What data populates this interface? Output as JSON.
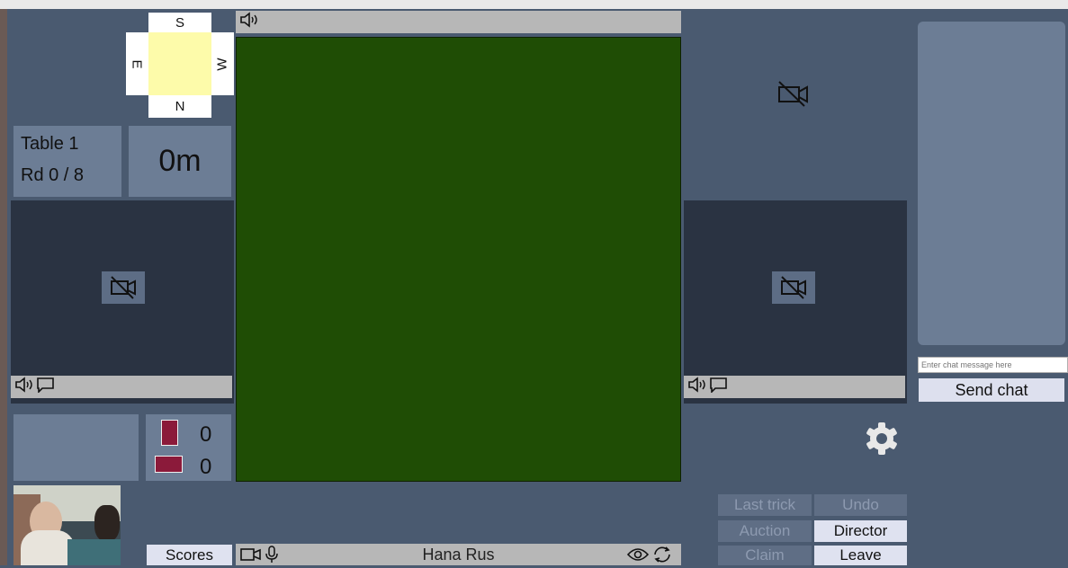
{
  "compass": {
    "south": "S",
    "north": "N",
    "east": "E",
    "west": "W"
  },
  "table": {
    "name": "Table 1",
    "round": "Rd 0 / 8",
    "timer": "0m"
  },
  "counts": {
    "vertical": "0",
    "horizontal": "0"
  },
  "chat": {
    "placeholder": "Enter chat message here",
    "send_label": "Send chat"
  },
  "buttons": {
    "scores": "Scores",
    "last_trick": "Last trick",
    "undo": "Undo",
    "auction": "Auction",
    "director": "Director",
    "claim": "Claim",
    "leave": "Leave"
  },
  "player": {
    "name": "Hana Rus"
  },
  "colors": {
    "table_green": "#1f4d05",
    "card_maroon": "#8b1a3a",
    "compass_yellow": "#fdfbaa"
  },
  "icons": [
    "speaker-icon",
    "chat-bubble-icon",
    "camera-off-icon",
    "camera-icon",
    "microphone-icon",
    "eye-icon",
    "refresh-icon",
    "gear-icon"
  ]
}
